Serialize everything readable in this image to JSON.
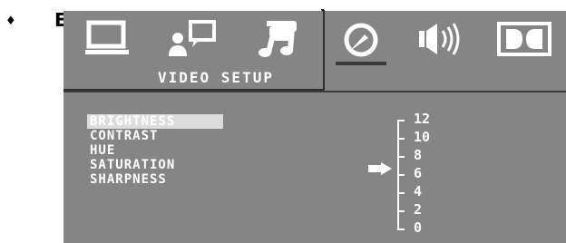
{
  "page": {
    "bullet": "♦",
    "cut_text": "E",
    "cut_paren": ")"
  },
  "tabs": [
    {
      "icon": "monitor-icon",
      "active": false
    },
    {
      "icon": "speech-bubble-person-icon",
      "active": false
    },
    {
      "icon": "music-note-icon",
      "active": false
    },
    {
      "icon": "video-dial-icon",
      "active": true
    },
    {
      "icon": "speaker-icon",
      "active": false
    },
    {
      "icon": "dolby-icon",
      "active": false
    }
  ],
  "setup": {
    "title": "VIDEO SETUP"
  },
  "menu": {
    "items": [
      "BRIGHTNESS",
      "CONTRAST",
      "HUE",
      "SATURATION",
      "SHARPNESS"
    ],
    "selected_index": 0
  },
  "scale": {
    "labels": [
      "12",
      "10",
      "8",
      "6",
      "4",
      "2",
      "0"
    ],
    "current_value": "6"
  },
  "colors": {
    "background": "#858585",
    "text": "#ffffff",
    "selection": "#dcdcdc"
  }
}
